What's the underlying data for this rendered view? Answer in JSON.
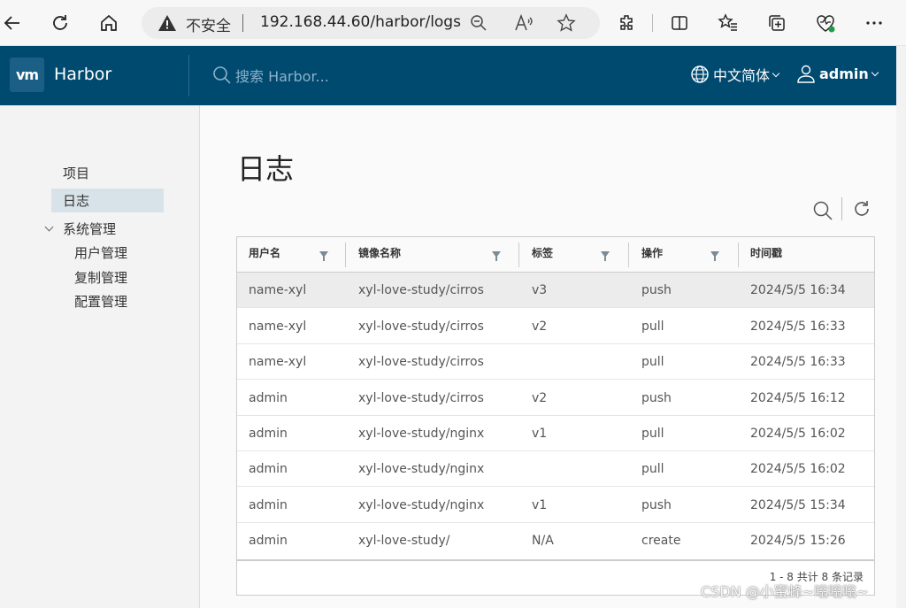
{
  "browser": {
    "security_label": "不安全",
    "url": "192.168.44.60/harbor/logs"
  },
  "header": {
    "app_name": "Harbor",
    "logo_text": "vm",
    "search_placeholder": "搜索 Harbor...",
    "language": "中文简体",
    "username": "admin",
    "accent_color": "#004a70"
  },
  "sidebar": {
    "items": [
      {
        "label": "项目"
      },
      {
        "label": "日志",
        "active": true
      },
      {
        "label": "系统管理"
      }
    ],
    "admin_children": [
      {
        "label": "用户管理"
      },
      {
        "label": "复制管理"
      },
      {
        "label": "配置管理"
      }
    ]
  },
  "main": {
    "title": "日志",
    "columns": [
      "用户名",
      "镜像名称",
      "标签",
      "操作",
      "时间戳"
    ],
    "rows": [
      {
        "user": "name-xyl",
        "repo": "xyl-love-study/cirros",
        "tag": "v3",
        "op": "push",
        "time": "2024/5/5 16:34"
      },
      {
        "user": "name-xyl",
        "repo": "xyl-love-study/cirros",
        "tag": "v2",
        "op": "pull",
        "time": "2024/5/5 16:33"
      },
      {
        "user": "name-xyl",
        "repo": "xyl-love-study/cirros",
        "tag": "",
        "op": "pull",
        "time": "2024/5/5 16:33"
      },
      {
        "user": "admin",
        "repo": "xyl-love-study/cirros",
        "tag": "v2",
        "op": "push",
        "time": "2024/5/5 16:12"
      },
      {
        "user": "admin",
        "repo": "xyl-love-study/nginx",
        "tag": "v1",
        "op": "pull",
        "time": "2024/5/5 16:02"
      },
      {
        "user": "admin",
        "repo": "xyl-love-study/nginx",
        "tag": "",
        "op": "pull",
        "time": "2024/5/5 16:02"
      },
      {
        "user": "admin",
        "repo": "xyl-love-study/nginx",
        "tag": "v1",
        "op": "push",
        "time": "2024/5/5 15:34"
      },
      {
        "user": "admin",
        "repo": "xyl-love-study/",
        "tag": "N/A",
        "op": "create",
        "time": "2024/5/5 15:26"
      }
    ],
    "footer": "1 - 8 共计 8 条记录"
  },
  "watermark": "CSDN @小蜜蜂~嗡嗡嗡~"
}
